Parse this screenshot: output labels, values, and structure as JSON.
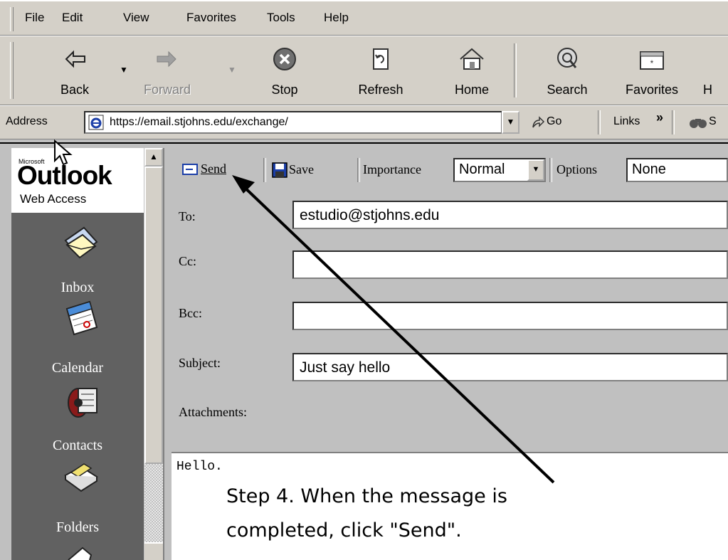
{
  "menu": [
    "File",
    "Edit",
    "View",
    "Favorites",
    "Tools",
    "Help"
  ],
  "toolbar": {
    "back": "Back",
    "forward": "Forward",
    "stop": "Stop",
    "refresh": "Refresh",
    "home": "Home",
    "search": "Search",
    "favorites": "Favorites",
    "history": "H"
  },
  "address": {
    "label": "Address",
    "url": "https://email.stjohns.edu/exchange/",
    "go": "Go",
    "links": "Links",
    "extra": "S"
  },
  "owa": {
    "brand_small": "Microsoft",
    "brand": "Outlook",
    "brand_sub": "Web Access",
    "nav": [
      "Inbox",
      "Calendar",
      "Contacts",
      "Folders"
    ]
  },
  "compose": {
    "send": "Send",
    "save": "Save",
    "importance_label": "Importance",
    "importance_value": "Normal",
    "options_label": "Options",
    "options_value": "None",
    "to_label": "To:",
    "to_value": "estudio@stjohns.edu",
    "cc_label": "Cc:",
    "cc_value": "",
    "bcc_label": "Bcc:",
    "bcc_value": "",
    "subject_label": "Subject:",
    "subject_value": "Just say hello",
    "attachments_label": "Attachments:",
    "body": "Hello."
  },
  "annotation": {
    "line1": "Step 4. When the message is",
    "line2": "completed, click \"Send\"."
  }
}
